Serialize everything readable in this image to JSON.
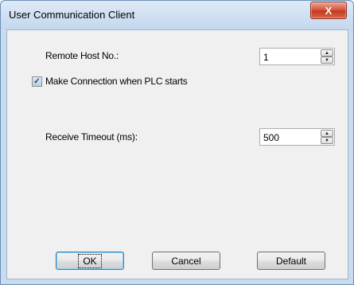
{
  "window": {
    "title": "User Communication Client",
    "close_glyph": "X"
  },
  "form": {
    "remote_host_label": "Remote Host No.:",
    "remote_host_value": "1",
    "make_connection_label": "Make Connection when PLC starts",
    "make_connection_checked": true,
    "receive_timeout_label": "Receive Timeout (ms):",
    "receive_timeout_value": "500"
  },
  "buttons": {
    "ok": "OK",
    "cancel": "Cancel",
    "default": "Default"
  },
  "icons": {
    "up": "spin-up-icon",
    "down": "spin-down-icon",
    "check": "check-icon",
    "close": "close-icon"
  }
}
